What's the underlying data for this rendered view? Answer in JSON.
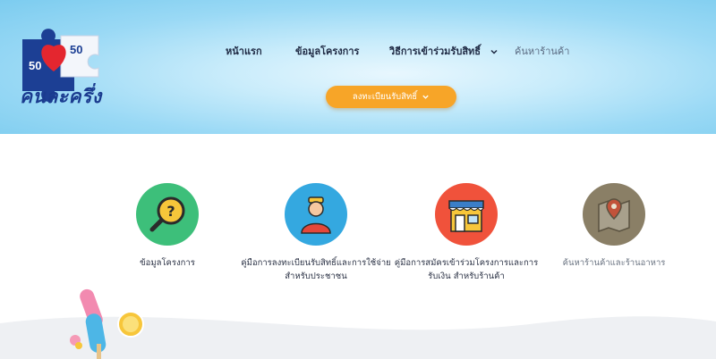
{
  "brand": {
    "logo_numbers": [
      "50",
      "50"
    ],
    "name": "คนละครึ่ง"
  },
  "nav": {
    "items": [
      {
        "label": "หน้าแรก"
      },
      {
        "label": "ข้อมูลโครงการ"
      },
      {
        "label": "วิธีการเข้าร่วมรับสิทธิ์"
      },
      {
        "label": "ค้นหาร้านค้า"
      }
    ]
  },
  "register": {
    "label": "ลงทะเบียนรับสิทธิ์"
  },
  "features": [
    {
      "label": "ข้อมูลโครงการ",
      "icon": "search-question-icon",
      "color": "#3dbf7a"
    },
    {
      "label": "คู่มือการลงทะเบียนรับสิทธิ์และการใช้จ่าย สำหรับประชาชน",
      "icon": "person-icon",
      "color": "#34a8e0"
    },
    {
      "label": "คู่มือการสมัครเข้าร่วมโครงการและการรับเงิน สำหรับร้านค้า",
      "icon": "shop-icon",
      "color": "#f0523b"
    },
    {
      "label": "ค้นหาร้านค้าและร้านอาหาร",
      "icon": "map-pin-icon",
      "color": "#8a7f66"
    }
  ]
}
